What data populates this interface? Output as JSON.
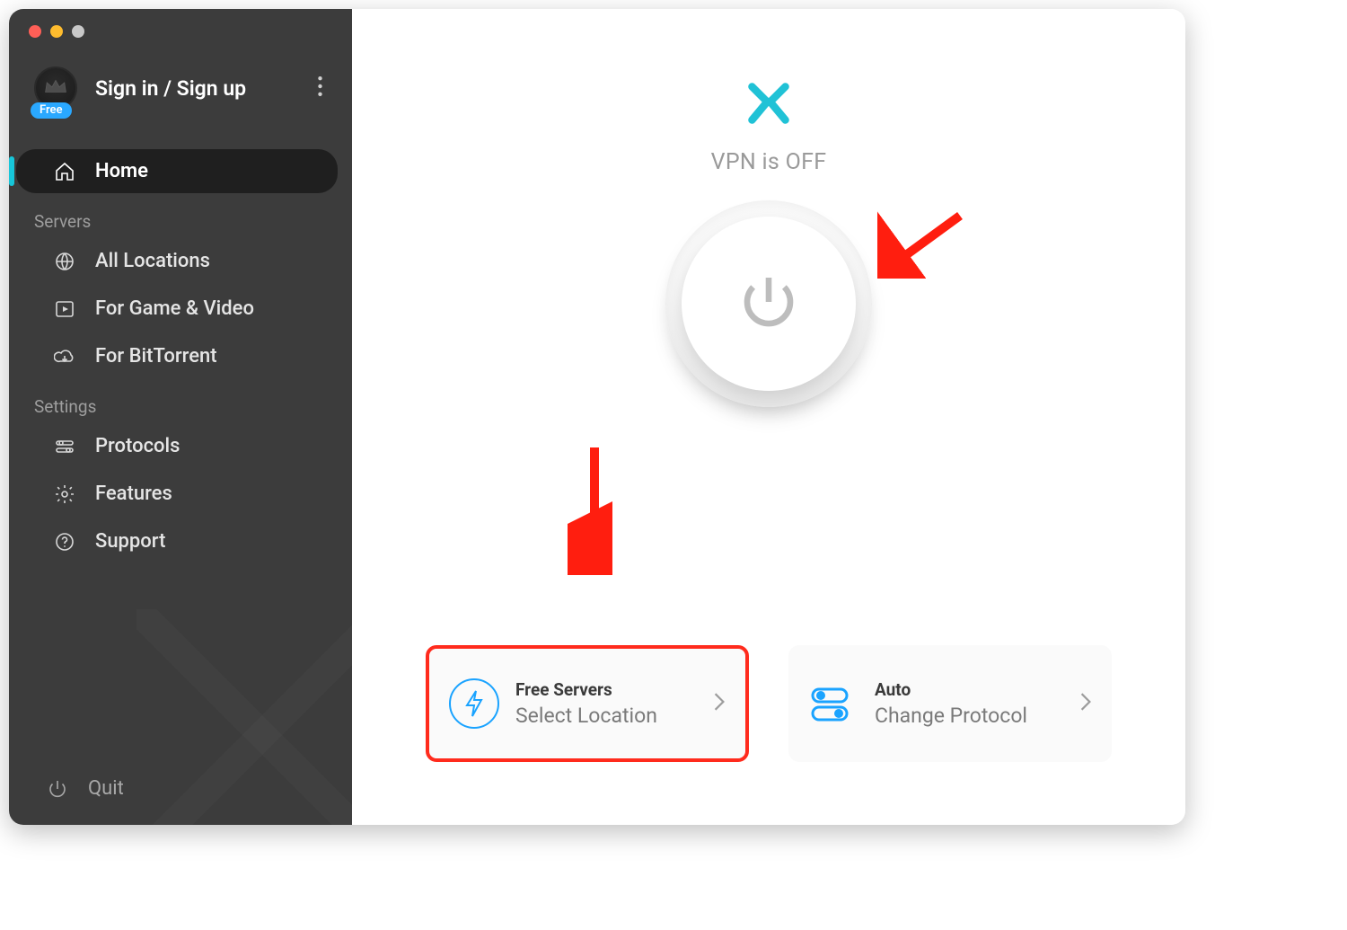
{
  "sidebar": {
    "account_title": "Sign in / Sign up",
    "free_badge": "Free",
    "sections": {
      "servers_label": "Servers",
      "settings_label": "Settings"
    },
    "items": {
      "home": "Home",
      "all_locations": "All Locations",
      "game_video": "For Game & Video",
      "bittorrent": "For BitTorrent",
      "protocols": "Protocols",
      "features": "Features",
      "support": "Support",
      "quit": "Quit"
    }
  },
  "main": {
    "status_text": "VPN is OFF",
    "cards": {
      "servers": {
        "title": "Free Servers",
        "subtitle": "Select Location"
      },
      "protocol": {
        "title": "Auto",
        "subtitle": "Change Protocol"
      }
    }
  }
}
